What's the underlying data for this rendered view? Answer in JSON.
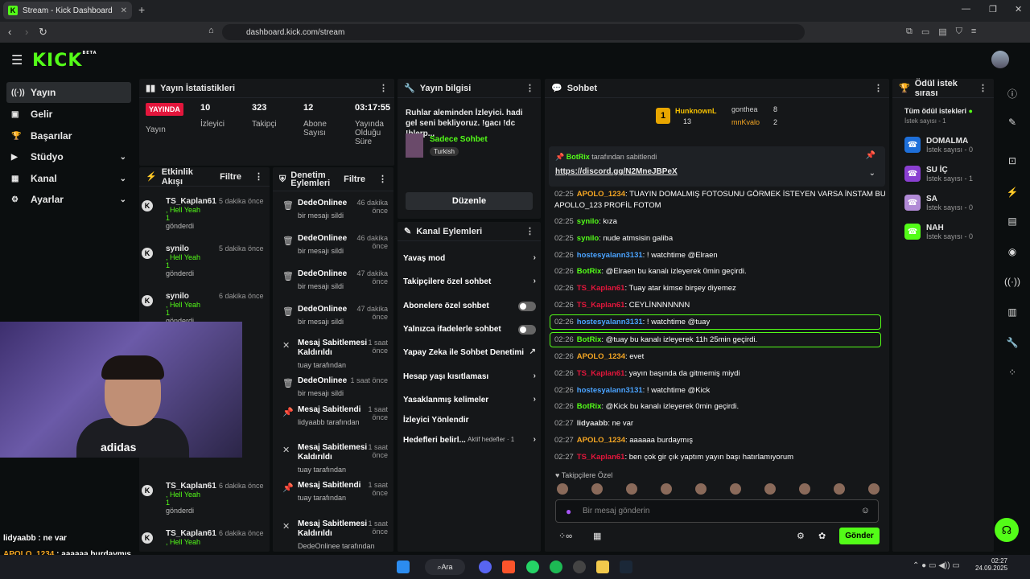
{
  "browser": {
    "tab_title": "Stream - Kick Dashboard",
    "url": "dashboard.kick.com/stream"
  },
  "app": {
    "logo": "KICK",
    "logo_sup": "BETA"
  },
  "sidebar": [
    {
      "icon": "((·))",
      "label": "Yayın"
    },
    {
      "icon": "▣",
      "label": "Gelir"
    },
    {
      "icon": "🏆",
      "label": "Başarılar"
    },
    {
      "icon": "▶",
      "label": "Stüdyo"
    },
    {
      "icon": "▦",
      "label": "Kanal"
    },
    {
      "icon": "⚙",
      "label": "Ayarlar"
    }
  ],
  "stats": {
    "title": "Yayın İstatistikleri",
    "live": "YAYINDA",
    "live_sub": "Yayın",
    "viewers": "10",
    "viewers_l": "İzleyici",
    "followers": "323",
    "followers_l": "Takipçi",
    "subs": "12",
    "subs_l1": "Abone",
    "subs_l2": "Sayısı",
    "time": "03:17:55",
    "time_l1": "Yayında",
    "time_l2": "Olduğu",
    "time_l3": "Süre"
  },
  "info": {
    "title": "Yayın bilgisi",
    "desc": "Ruhlar aleminden İzleyici. hadi gel seni bekliyoruz. !gacı !dc !blerp...",
    "category": "Sadece Sohbet",
    "lang": "Turkish",
    "edit": "Düzenle"
  },
  "feed": {
    "title": "Etkinlik Akışı",
    "filter": "Filtre",
    "items": [
      {
        "n": "TS_Kaplan61",
        "g": ", Hell Yeah",
        "c": "1",
        "s": "gönderdi",
        "t": "5 dakika önce"
      },
      {
        "n": "synilo",
        "g": ", Hell Yeah",
        "c": "1",
        "s": "gönderdi",
        "t": "5 dakika önce"
      },
      {
        "n": "synilo",
        "g": ", Hell Yeah",
        "c": "1",
        "s": "gönderdi",
        "t": "6 dakika önce"
      },
      {
        "n": "TS_Kaplan61",
        "g": ", Hell Yeah",
        "c": "1",
        "s": "gönderdi",
        "t": "6 dakika önce"
      },
      {
        "n": "TS_Kaplan61",
        "g": ", Hell Yeah",
        "c": "",
        "s": "",
        "t": "6 dakika önce"
      }
    ]
  },
  "modlog": {
    "title1": "Denetim",
    "title2": "Eylemleri",
    "filter": "Filtre",
    "items": [
      {
        "n": "DedeOnlinee",
        "s": "bir mesajı sildi",
        "t1": "46 dakika",
        "t2": "önce",
        "ic": "🗑"
      },
      {
        "n": "DedeOnlinee",
        "s": "bir mesajı sildi",
        "t1": "46 dakika",
        "t2": "önce",
        "ic": "🗑"
      },
      {
        "n": "DedeOnlinee",
        "s": "bir mesajı sildi",
        "t1": "47 dakika",
        "t2": "önce",
        "ic": "🗑"
      },
      {
        "n": "DedeOnlinee",
        "s": "bir mesajı sildi",
        "t1": "47 dakika",
        "t2": "önce",
        "ic": "🗑"
      },
      {
        "n": "Mesaj Sabitlemesi Kaldırıldı",
        "s": "tuay tarafından",
        "t1": "1 saat",
        "t2": "önce",
        "ic": "✕"
      },
      {
        "n": "DedeOnlinee",
        "s": "bir mesajı sildi",
        "t1": "1 saat önce",
        "t2": "",
        "ic": "🗑"
      },
      {
        "n": "Mesaj Sabitlendi",
        "s": "lidyaabb tarafından",
        "t1": "1 saat",
        "t2": "önce",
        "ic": "📌"
      },
      {
        "n": "Mesaj Sabitlemesi Kaldırıldı",
        "s": "tuay tarafından",
        "t1": "1 saat",
        "t2": "önce",
        "ic": "✕"
      },
      {
        "n": "Mesaj Sabitlendi",
        "s": "tuay tarafından",
        "t1": "1 saat",
        "t2": "önce",
        "ic": "📌"
      },
      {
        "n": "Mesaj Sabitlemesi Kaldırıldı",
        "s": "DedeOnlinee tarafından",
        "t1": "1 saat",
        "t2": "önce",
        "ic": "✕"
      }
    ]
  },
  "actions": {
    "title": "Kanal Eylemleri",
    "items": [
      "Yavaş mod",
      "Takipçilere özel sohbet",
      "Abonelere özel sohbet",
      "Yalnızca ifadelerle sohbet",
      "Yapay Zeka ile Sohbet Denetimi",
      "Hesap yaşı kısıtlaması",
      "Yasaklanmış kelimeler",
      "İzleyici Yönlendir",
      "Hedefleri belirl..."
    ],
    "goal_active": "Aktif hedefler · 1"
  },
  "chat": {
    "title": "Sohbet",
    "top1": "HunknownL",
    "top1c": "13",
    "top2": "gonthea",
    "top2c": "8",
    "top3": "mnKvalo",
    "top3c": "2",
    "pinned_by": "BotRix",
    "pinned_suffix": "tarafından sabitlendi",
    "pinned_link": "https://discord.gg/N2MneJBPeX",
    "lines": [
      {
        "tm": "02:25",
        "u": "APOLO_1234",
        "c": "#f5a623",
        "m": ": TUAYIN DOMALMIŞ FOTOSUNU GÖRMEK İSTEYEN VARSA İNSTAM BU"
      },
      {
        "tm": "",
        "u": "",
        "c": "#fff",
        "m": "APOLLO_123 PROFİL FOTOM"
      },
      {
        "tm": "02:25",
        "u": "synilo",
        "c": "#53fc18",
        "m": ": kıza"
      },
      {
        "tm": "02:25",
        "u": "synilo",
        "c": "#53fc18",
        "m": ": nude atmsisin galiba"
      },
      {
        "tm": "02:26",
        "u": "hostesyalann3131",
        "c": "#4aa3ff",
        "m": ": ! watchtime @Elraen"
      },
      {
        "tm": "02:26",
        "u": "BotRix",
        "c": "#53fc18",
        "m": ": @Elraen bu kanalı izleyerek 0min geçirdi."
      },
      {
        "tm": "02:26",
        "u": "TS_Kaplan61",
        "c": "#e3163c",
        "m": ": Tuay atar kimse birşey diyemez"
      },
      {
        "tm": "02:26",
        "u": "TS_Kaplan61",
        "c": "#e3163c",
        "m": ": CEYLİNNNNNNN"
      },
      {
        "tm": "02:26",
        "u": "hostesyalann3131",
        "c": "#4aa3ff",
        "m": ": ! watchtime @tuay"
      },
      {
        "tm": "02:26",
        "u": "BotRix",
        "c": "#53fc18",
        "m": ": @tuay bu kanalı izleyerek 11h 25min geçirdi."
      },
      {
        "tm": "02:26",
        "u": "APOLO_1234",
        "c": "#f5a623",
        "m": ": evet"
      },
      {
        "tm": "02:26",
        "u": "TS_Kaplan61",
        "c": "#e3163c",
        "m": ": yayın başında da gitmemiş miydi"
      },
      {
        "tm": "02:26",
        "u": "hostesyalann3131",
        "c": "#4aa3ff",
        "m": ": ! watchtime @Kick"
      },
      {
        "tm": "02:26",
        "u": "BotRix",
        "c": "#53fc18",
        "m": ": @Kick bu kanalı izleyerek 0min geçirdi."
      },
      {
        "tm": "02:27",
        "u": "lidyaabb",
        "c": "#ddd",
        "m": ": ne var"
      },
      {
        "tm": "02:27",
        "u": "APOLO_1234",
        "c": "#f5a623",
        "m": ": aaaaaa burdaymış"
      },
      {
        "tm": "02:27",
        "u": "TS_Kaplan61",
        "c": "#e3163c",
        "m": ": ben çok gir çık yaptım yayın başı hatırlamıyorum"
      }
    ],
    "followers_only": "Takipçilere Özel",
    "placeholder": "Bir mesaj gönderin",
    "send": "Gönder"
  },
  "rewards": {
    "title": "Ödül istek sırası",
    "all": "Tüm ödül istekleri",
    "all_sub": "İstek sayısı - 1",
    "items": [
      {
        "n": "DOMALMA",
        "s": "İstek sayısı - 0",
        "c": "#1e6fd9"
      },
      {
        "n": "SU İÇ",
        "s": "İstek sayısı - 1",
        "c": "#8a3fd1"
      },
      {
        "n": "SA",
        "s": "İstek sayısı - 0",
        "c": "#b18ad6"
      },
      {
        "n": "NAH",
        "s": "İstek sayısı - 0",
        "c": "#53fc18"
      }
    ]
  },
  "overlay": [
    {
      "u": "lidyaabb",
      "m": " : ne var",
      "c": "#fff"
    },
    {
      "u": "APOLO_1234",
      "m": " : aaaaaa burdaymış",
      "c": "#f5a623"
    },
    {
      "u": "TS_Kaplan61",
      "m": " : ben çok gir çık yaptım yayın başı hatırlamıyorum",
      "c": "#e3163c"
    }
  ],
  "cam": {
    "shirt_text": "adidas"
  },
  "taskbar": {
    "search": "Ara",
    "time": "02:27",
    "date": "24.09.2025"
  }
}
